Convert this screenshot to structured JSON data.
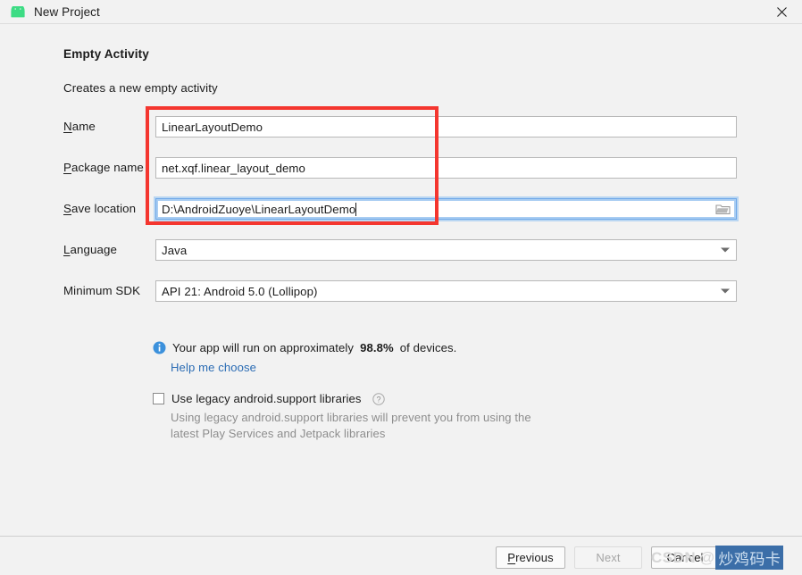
{
  "window": {
    "title": "New Project",
    "app_icon": "android-robot-icon",
    "close_icon": "close-icon"
  },
  "page": {
    "heading": "Empty Activity",
    "subheading": "Creates a new empty activity"
  },
  "form": {
    "fields": [
      {
        "label_mnemonic": "N",
        "label_rest": "ame",
        "name": "name",
        "value": "LinearLayoutDemo",
        "focused": false,
        "type": "text"
      },
      {
        "label_mnemonic": "P",
        "label_rest": "ackage name",
        "name": "package-name",
        "value": "net.xqf.linear_layout_demo",
        "focused": false,
        "type": "text"
      },
      {
        "label_mnemonic": "S",
        "label_rest": "ave location",
        "name": "save-location",
        "value": "D:\\AndroidZuoye\\LinearLayoutDemo",
        "focused": true,
        "type": "text-with-browse",
        "browse_icon": "folder-icon"
      },
      {
        "label_mnemonic": "L",
        "label_rest": "anguage",
        "name": "language",
        "value": "Java",
        "type": "combo"
      },
      {
        "label_mnemonic": "",
        "label_rest": "Minimum SDK",
        "name": "minimum-sdk",
        "value": "API 21: Android 5.0 (Lollipop)",
        "type": "combo"
      }
    ]
  },
  "info": {
    "icon": "info-icon",
    "text_before": "Your app will run on approximately",
    "percent": "98.8%",
    "text_after": "of devices.",
    "help_link": "Help me choose"
  },
  "legacy": {
    "checkbox_checked": false,
    "label": "Use legacy android.support libraries",
    "help_icon": "question-mark-icon",
    "description": "Using legacy android.support libraries will prevent you from using the latest Play Services and Jetpack libraries"
  },
  "footer": {
    "previous_mnemonic": "P",
    "previous_rest": "revious",
    "next": "Next",
    "next_disabled": true,
    "cancel": "Cancel"
  },
  "annotation": {
    "color": "#f4362f",
    "shape": "rectangle"
  },
  "watermark": {
    "site": "CSDN",
    "at": "@",
    "author": "炒鸡码卡"
  },
  "colors": {
    "accent_blue": "#2b6cb4",
    "focus_border": "#6fa8e8",
    "annotation_red": "#f4362f",
    "android_green": "#3ddc84",
    "background": "#f2f2f2"
  }
}
